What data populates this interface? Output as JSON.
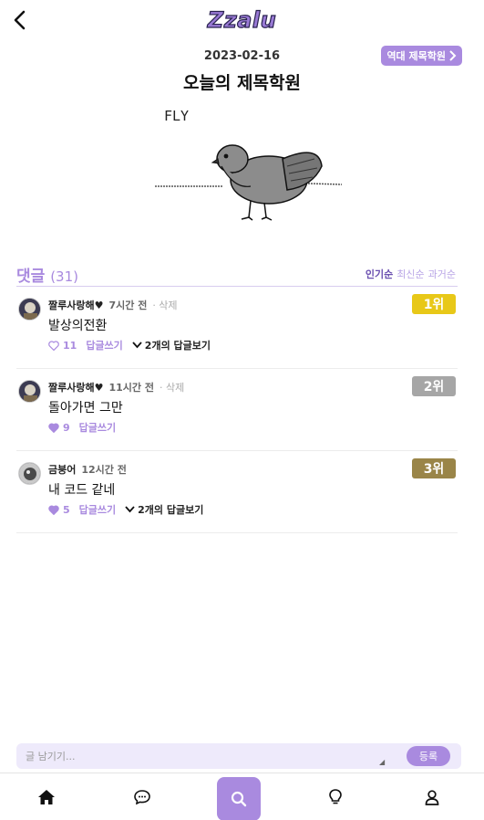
{
  "app": {
    "logo": "Zzalu"
  },
  "header": {
    "date": "2023-02-16",
    "title": "오늘의 제목학원",
    "hall_of_fame": "역대 제목학원"
  },
  "image": {
    "caption": "FLY"
  },
  "comments_section": {
    "label": "댓글",
    "count": "(31)",
    "sort": {
      "popular": "인기순",
      "newest": "최신순",
      "oldest": "과거순"
    }
  },
  "comments": [
    {
      "author": "짤루사랑해♥",
      "time": "7시간 전",
      "delete": "· 삭제",
      "text": "발상의전환",
      "likes": "11",
      "reply": "답글쓰기",
      "replies": "2개의 답글보기",
      "rank": "1위",
      "rank_color": "#e8c818",
      "liked": false
    },
    {
      "author": "짤루사랑해♥",
      "time": "11시간 전",
      "delete": "· 삭제",
      "text": "돌아가면 그만",
      "likes": "9",
      "reply": "답글쓰기",
      "replies": "",
      "rank": "2위",
      "rank_color": "#a6a6a6",
      "liked": true
    },
    {
      "author": "금붕어",
      "time": "12시간 전",
      "delete": "",
      "text": "내 코드 같네",
      "likes": "5",
      "reply": "답글쓰기",
      "replies": "2개의 답글보기",
      "rank": "3위",
      "rank_color": "#9a8548",
      "liked": true
    }
  ],
  "input": {
    "placeholder": "글 남기기...",
    "submit": "등록"
  },
  "colors": {
    "accent": "#a98adf",
    "accent_light": "#eeeafb",
    "gold": "#e8c818",
    "silver": "#a6a6a6",
    "bronze": "#9a8548"
  },
  "nav": {
    "icons": [
      "home-icon",
      "chat-icon",
      "search-icon",
      "lightbulb-icon",
      "user-icon"
    ]
  }
}
